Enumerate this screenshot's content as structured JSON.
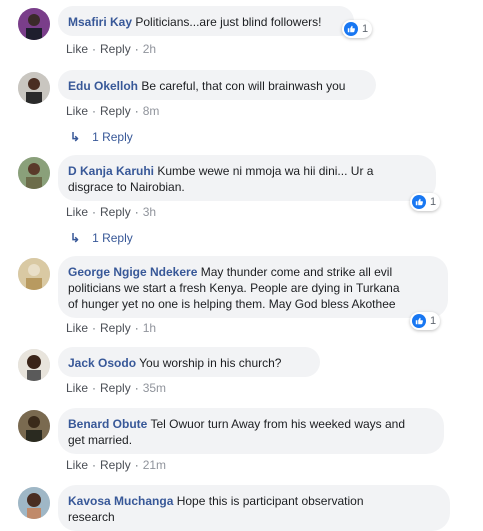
{
  "comments": [
    {
      "name": "Msafiri Kay",
      "text": "Politicians...are just blind followers!",
      "like": "Like",
      "reply": "Reply",
      "time": "2h",
      "reactions": "1"
    },
    {
      "name": "Edu Okelloh",
      "text": "Be careful, that con will brainwash you",
      "like": "Like",
      "reply": "Reply",
      "time": "8m",
      "replies": "1 Reply"
    },
    {
      "name": "D Kanja Karuhi",
      "text_line1": "Kumbe wewe ni mmoja wa hii dini... Ur a",
      "text_line2": "disgrace to Nairobian.",
      "like": "Like",
      "reply": "Reply",
      "time": "3h",
      "reactions": "1",
      "replies": "1 Reply"
    },
    {
      "name": "George Ngige Ndekere",
      "text_line1": "May thunder come and strike all evil",
      "text_line2": "politicians we start a fresh Kenya. People are dying in Turkana",
      "text_line3": "of hunger yet no one is helping them. May God bless Akothee",
      "like": "Like",
      "reply": "Reply",
      "time": "1h",
      "reactions": "1"
    },
    {
      "name": "Jack Osodo",
      "text": "You worship in his church?",
      "like": "Like",
      "reply": "Reply",
      "time": "35m"
    },
    {
      "name": "Benard Obute",
      "text_line1": "Tel Owuor turn Away from his weeked ways and",
      "text_line2": "get married.",
      "like": "Like",
      "reply": "Reply",
      "time": "21m"
    },
    {
      "name": "Kavosa Muchanga",
      "text_line1": "Hope this is participant observation",
      "text_line2": "research"
    }
  ],
  "colors": {
    "name": "#385898",
    "bubble": "#f2f3f5",
    "like_badge": "#1877f2",
    "action": "#606770"
  },
  "icons": {
    "like": "thumbs-up-icon",
    "reply_arrow": "reply-arrow-icon"
  }
}
